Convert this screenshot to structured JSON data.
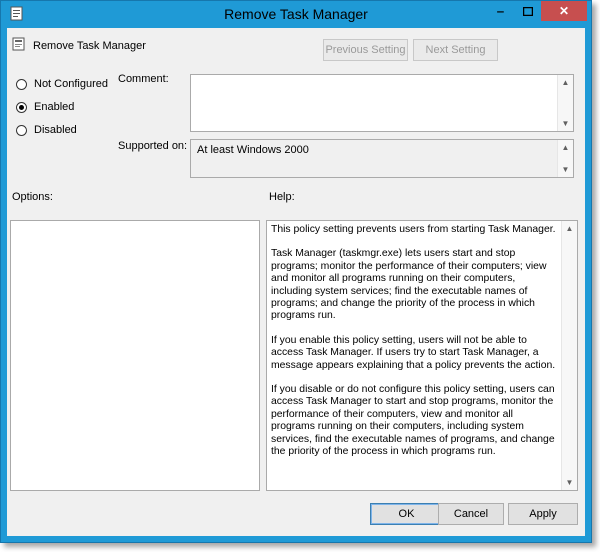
{
  "window": {
    "title": "Remove Task Manager",
    "controls": [
      "minimize-icon",
      "maximize-icon",
      "close-icon"
    ]
  },
  "policy": {
    "name": "Remove Task Manager"
  },
  "nav": {
    "previous_label": "Previous Setting",
    "next_label": "Next Setting"
  },
  "state": {
    "options": [
      {
        "label": "Not Configured",
        "checked": false
      },
      {
        "label": "Enabled",
        "checked": true
      },
      {
        "label": "Disabled",
        "checked": false
      }
    ]
  },
  "comment": {
    "label": "Comment:",
    "value": ""
  },
  "supported": {
    "label": "Supported on:",
    "value": "At least Windows 2000"
  },
  "options_panel": {
    "label": "Options:"
  },
  "help": {
    "label": "Help:",
    "paragraphs": [
      "This policy setting prevents users from starting Task Manager.",
      "Task Manager (taskmgr.exe) lets users start and stop programs; monitor the performance of their computers; view and monitor all programs running on their computers, including system services; find the executable names of programs; and change the priority of the process in which programs run.",
      "If you enable this policy setting, users will not be able to access Task Manager. If users try to start Task Manager, a message appears explaining that a policy prevents the action.",
      "If you disable or do not configure this policy setting, users can access Task Manager to  start and stop programs, monitor the performance of their computers, view and monitor all programs running on their computers, including system services, find the executable names of programs, and change the priority of the process in which programs run."
    ]
  },
  "buttons": {
    "ok": "OK",
    "cancel": "Cancel",
    "apply": "Apply"
  }
}
